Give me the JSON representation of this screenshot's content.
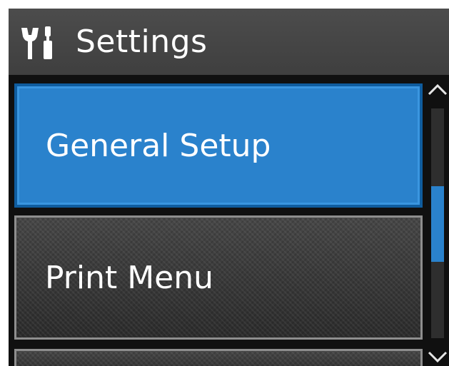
{
  "header": {
    "icon": "tools-icon",
    "title": "Settings"
  },
  "menu": {
    "items": [
      {
        "label": "General Setup",
        "selected": true
      },
      {
        "label": "Print Menu",
        "selected": false
      },
      {
        "label": "",
        "selected": false
      }
    ]
  },
  "scrollbar": {
    "up_icon": "chevron-up-icon",
    "down_icon": "chevron-down-icon",
    "thumb_start_fraction": 0.34,
    "thumb_size_fraction": 0.33
  },
  "colors": {
    "accent": "#2a82cc",
    "header_bg": "#464646",
    "screen_bg": "#101010"
  }
}
